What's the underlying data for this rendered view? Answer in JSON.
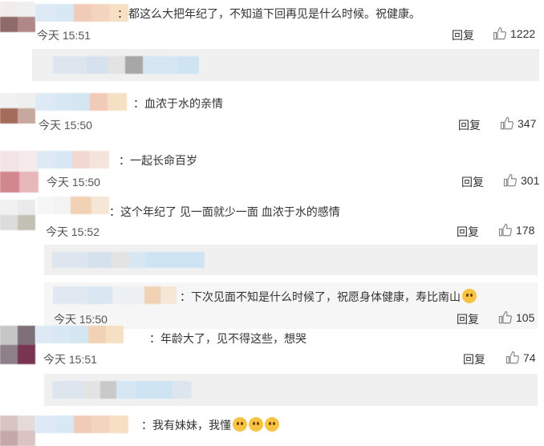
{
  "comments": [
    {
      "text": "：都这么大把年纪了，不知道下回再见是什么时候。祝健康。",
      "time": "今天 15:51",
      "reply": "回复",
      "likes": "1222"
    },
    {
      "text": "：血浓于水的亲情",
      "time": "今天 15:50",
      "reply": "回复",
      "likes": "347"
    },
    {
      "text": "：一起长命百岁",
      "time": "今天 15:50",
      "reply": "回复",
      "likes": "301"
    },
    {
      "text": "：这个年纪了 见一面就少一面 血浓于水的感情",
      "time": "今天 15:52",
      "reply": "回复",
      "likes": "178"
    },
    {
      "text": "：下次见面不知是什么时候了，祝愿身体健康，寿比南山",
      "time": "今天 15:50",
      "reply": "回复",
      "likes": "105"
    },
    {
      "text": "：年龄大了，见不得这些，想哭",
      "time": "今天 15:51",
      "reply": "回复",
      "likes": "74"
    },
    {
      "text": "：我有妹妹，我懂"
    }
  ],
  "emoji_icons": [
    "crying-face-icon"
  ],
  "colors": {
    "bar": "#f0f0f0",
    "text": "#333333",
    "emoji": "#f6c344"
  }
}
